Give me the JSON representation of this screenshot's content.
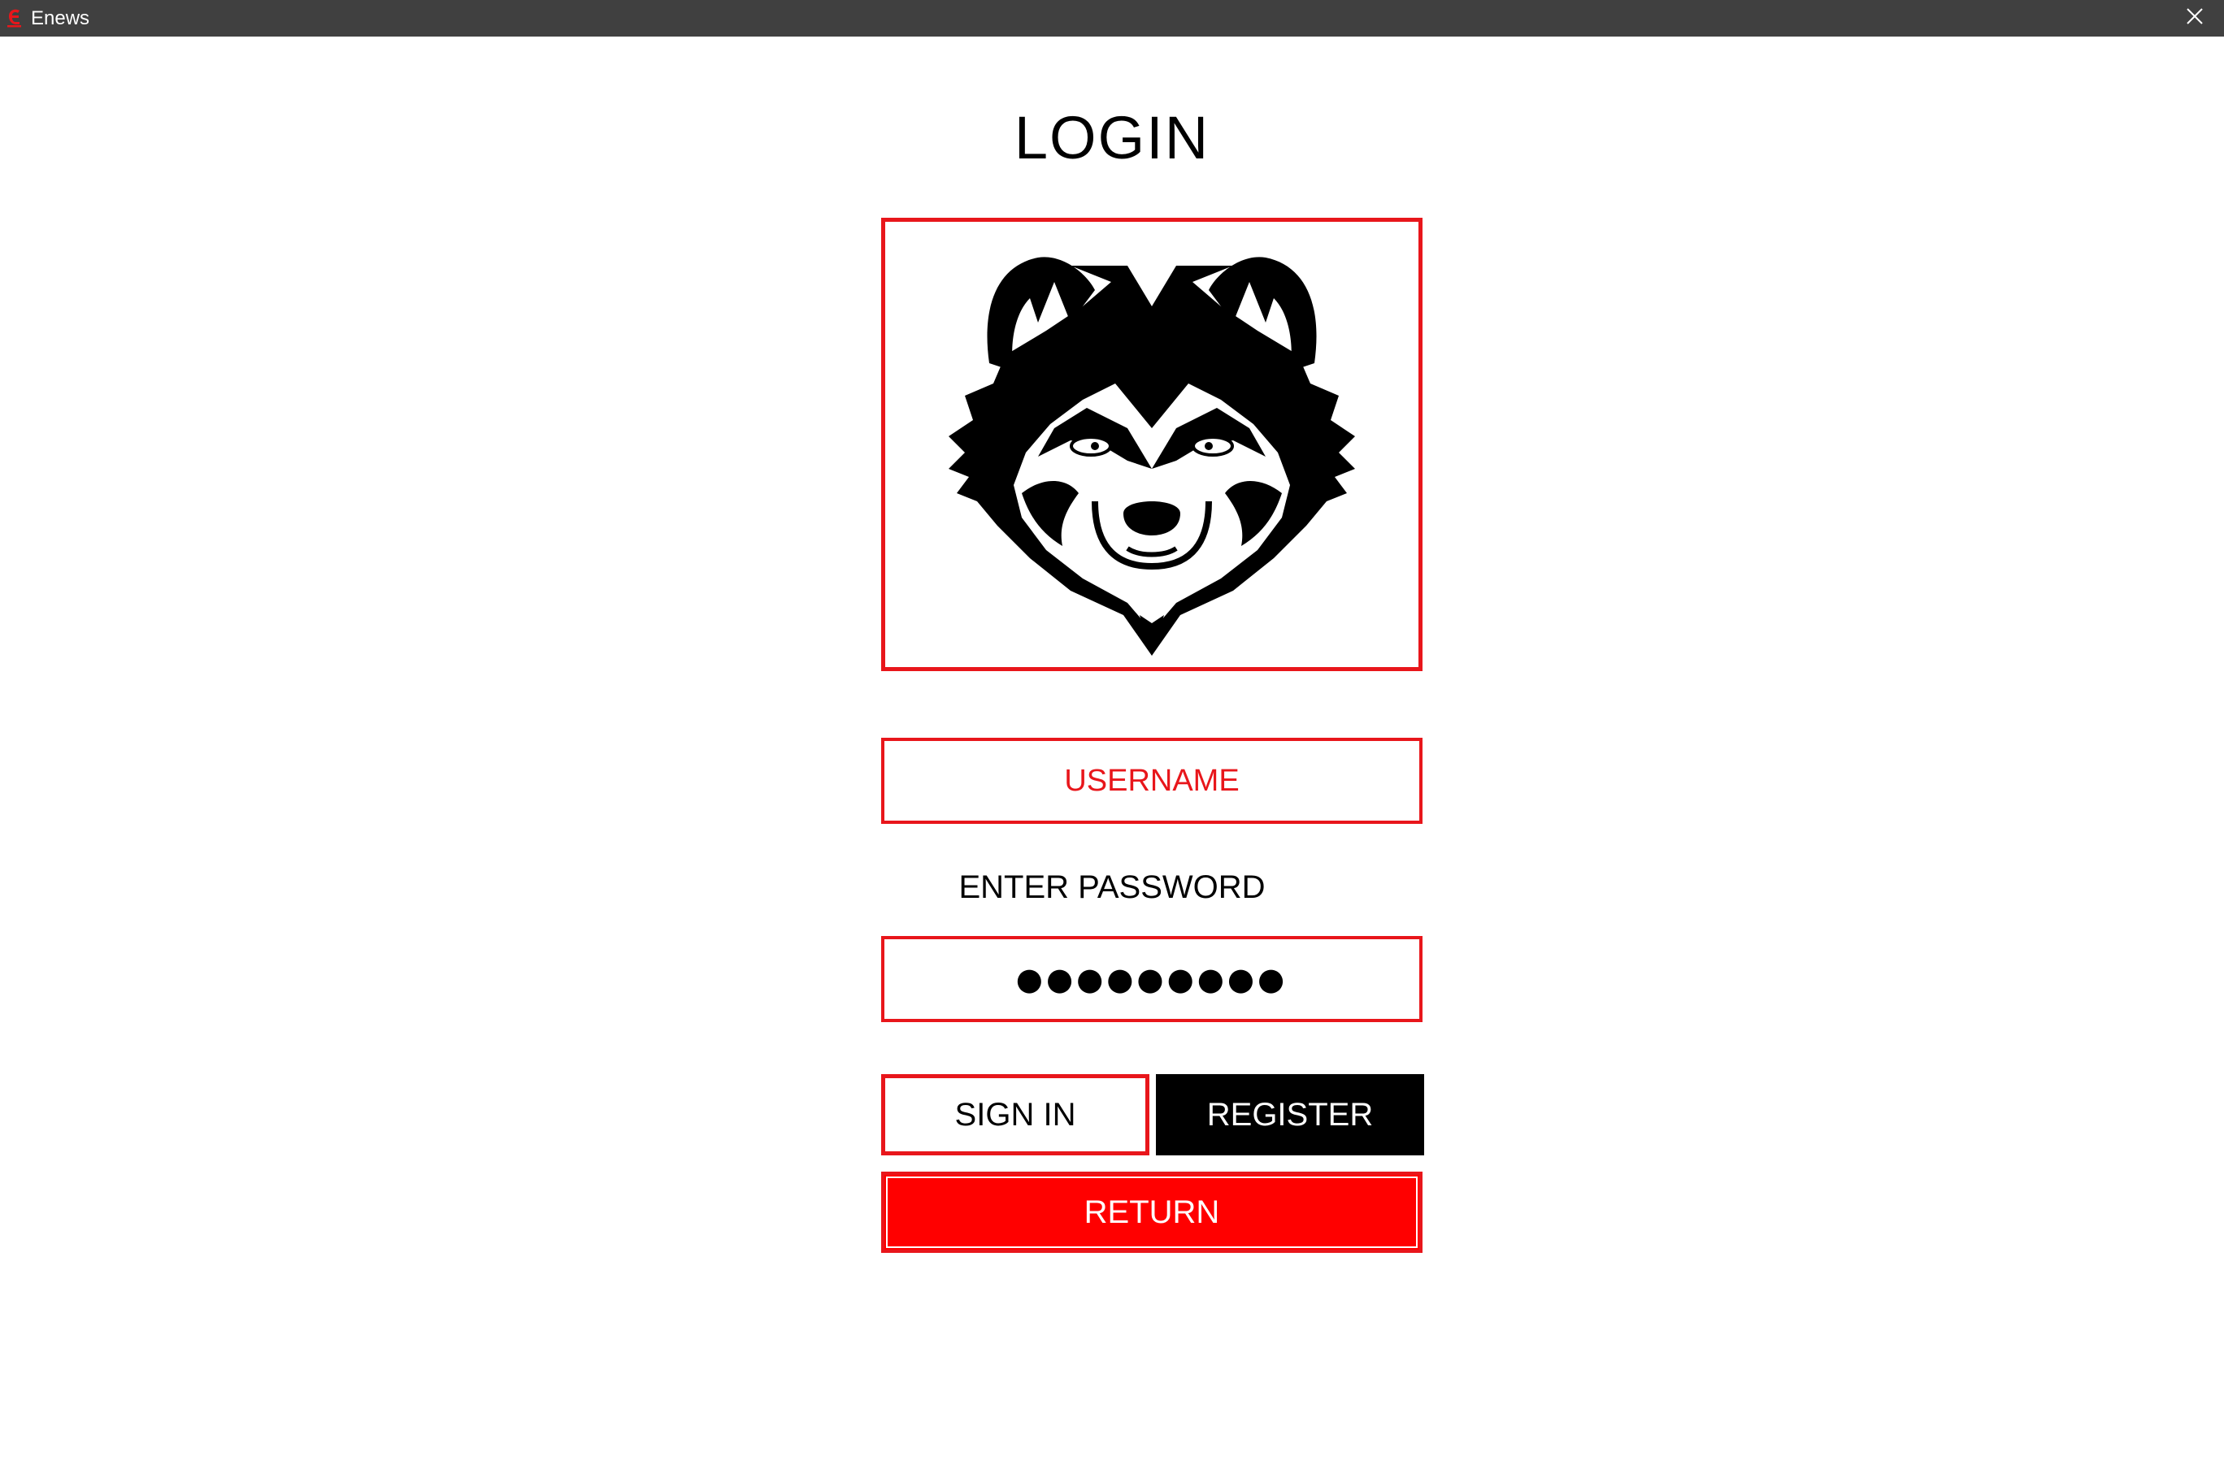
{
  "window": {
    "title": "Enews",
    "close_icon": "close-icon",
    "app_icon": "app-e-icon"
  },
  "login": {
    "title": "LOGIN",
    "logo": "wolf-logo",
    "username_placeholder": "USERNAME",
    "password_label": "ENTER PASSWORD",
    "password_masked": "●●●●●●●●●",
    "sign_in_label": "SIGN IN",
    "register_label": "REGISTER",
    "return_label": "RETURN"
  },
  "colors": {
    "accent": "#e8161b",
    "return_bg": "#ff0000",
    "titlebar": "#404040",
    "register_bg": "#000000"
  }
}
